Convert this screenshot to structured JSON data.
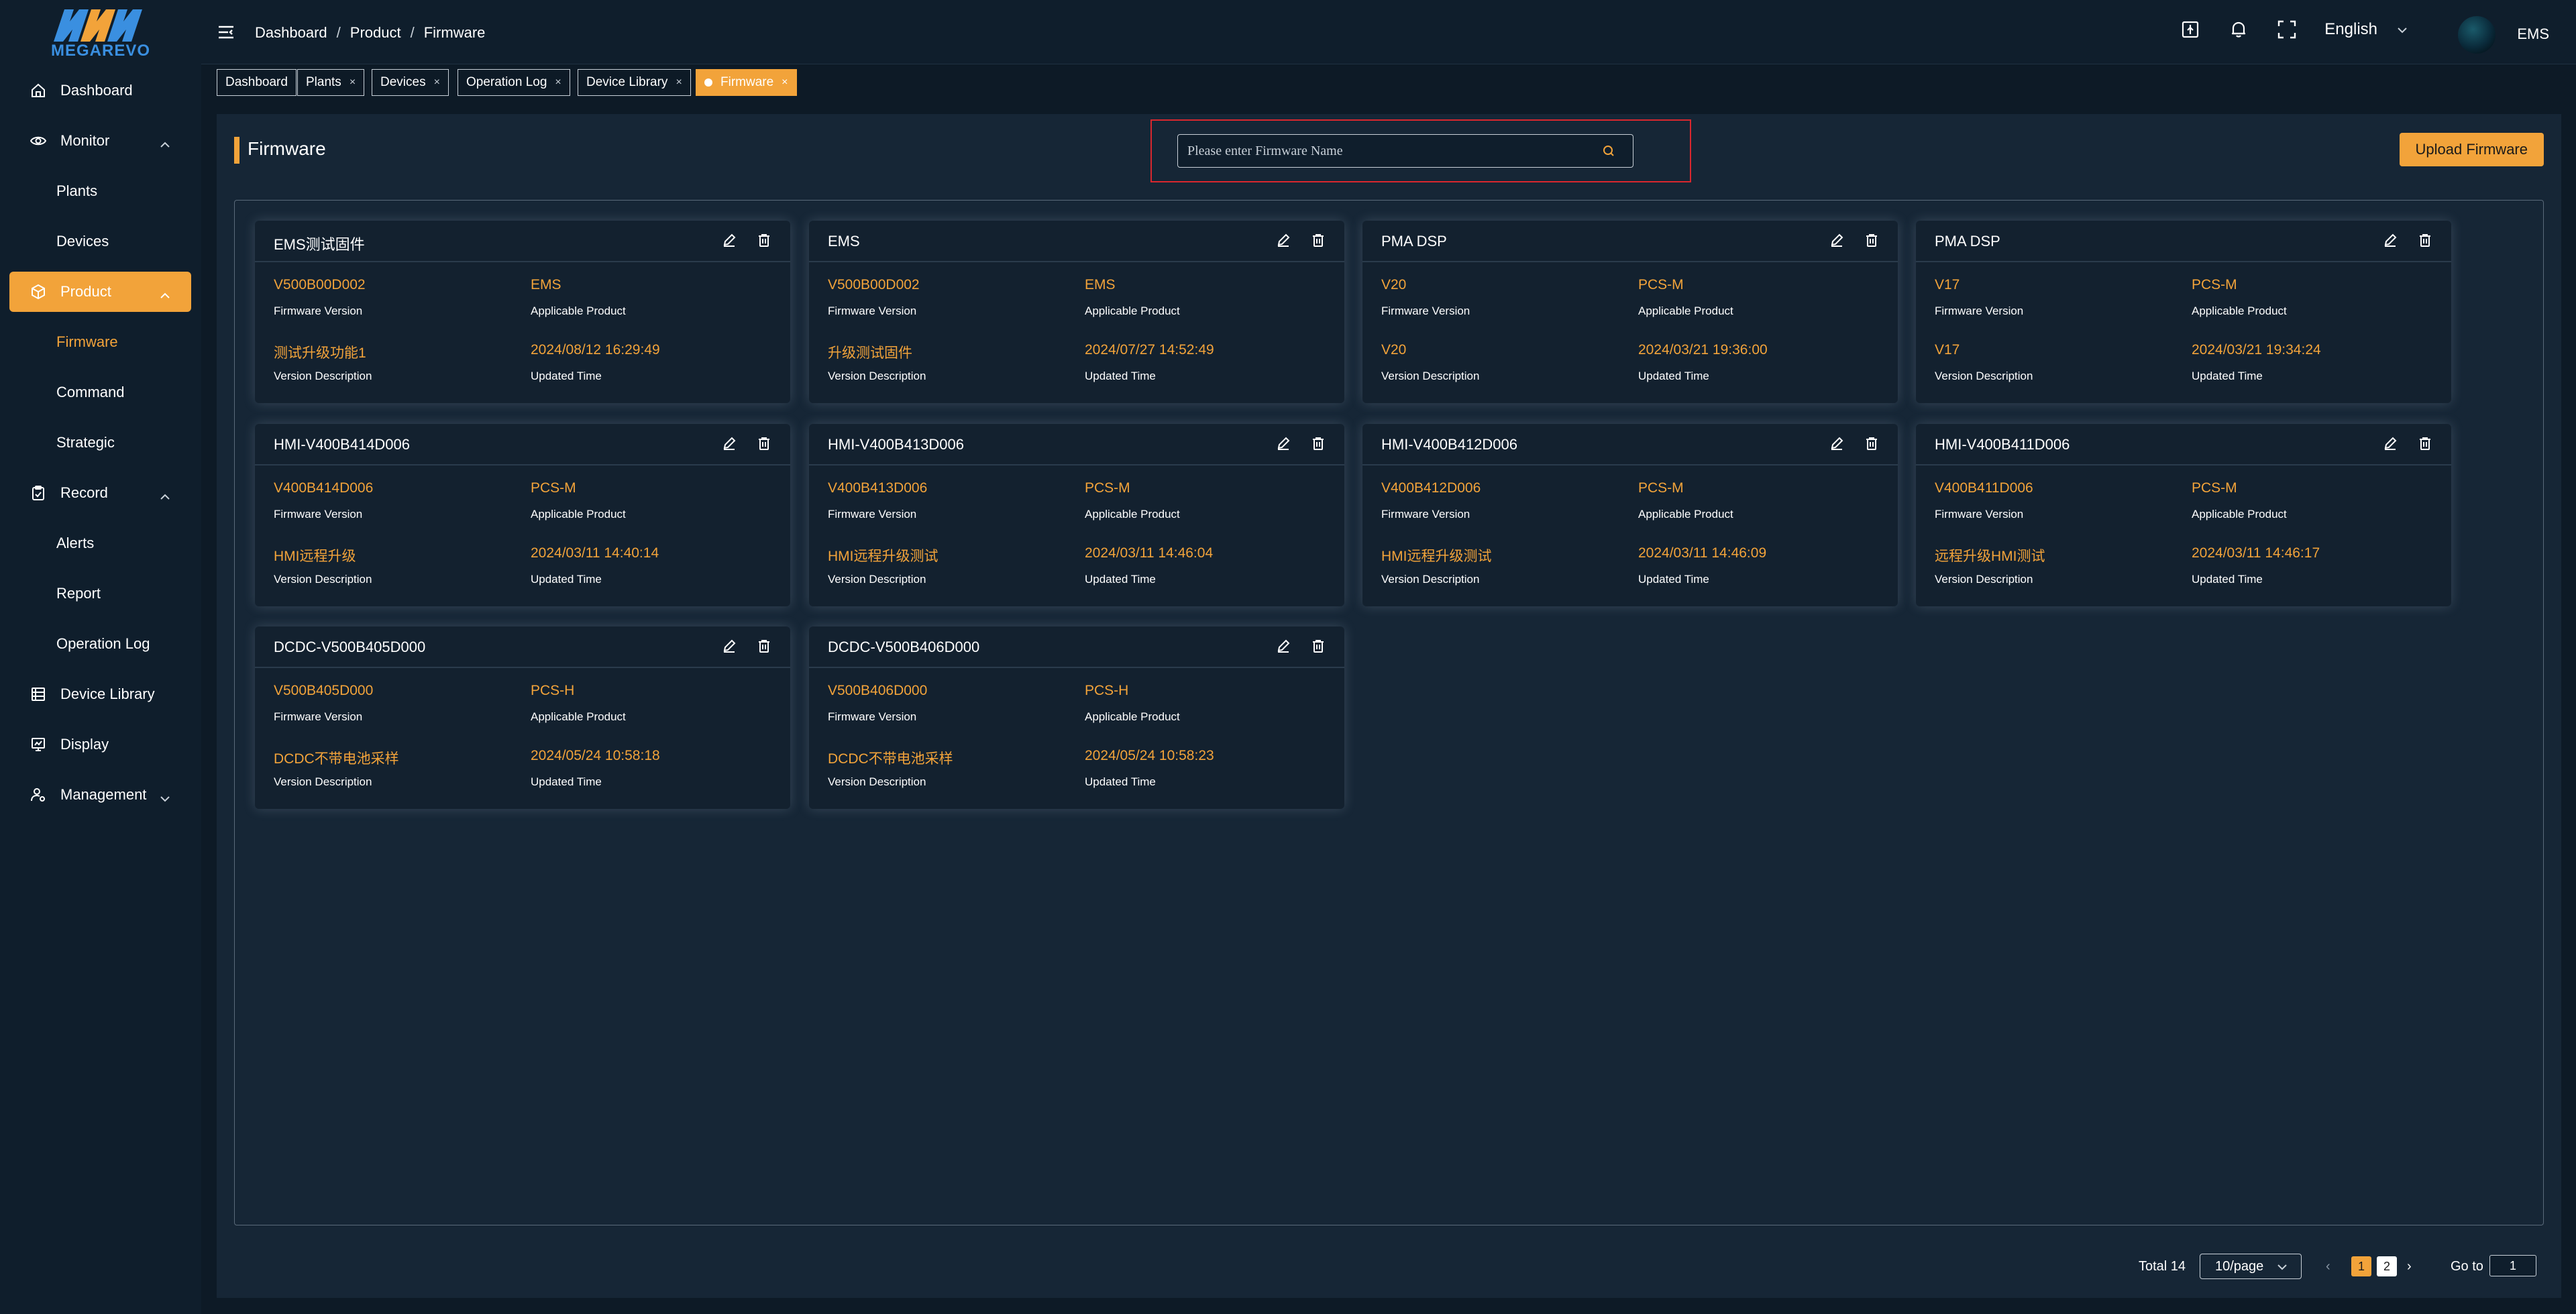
{
  "brand": {
    "logo_text": "MEGAREVO",
    "accent": "#f2a33a",
    "logo_blue": "#3a8fe0",
    "logo_orange": "#f2a33a"
  },
  "sidebar": {
    "items": [
      {
        "label": "Dashboard",
        "icon": "home-icon"
      },
      {
        "label": "Monitor",
        "icon": "eye-icon"
      },
      {
        "label": "Plants"
      },
      {
        "label": "Devices"
      },
      {
        "label": "Product",
        "icon": "box-icon"
      },
      {
        "label": "Firmware"
      },
      {
        "label": "Command"
      },
      {
        "label": "Strategic"
      },
      {
        "label": "Record",
        "icon": "clipboard-icon"
      },
      {
        "label": "Alerts"
      },
      {
        "label": "Report"
      },
      {
        "label": "Operation Log"
      },
      {
        "label": "Device Library",
        "icon": "library-icon"
      },
      {
        "label": "Display",
        "icon": "display-icon"
      },
      {
        "label": "Management",
        "icon": "user-gear-icon"
      }
    ]
  },
  "header": {
    "breadcrumb": [
      "Dashboard",
      "Product",
      "Firmware"
    ],
    "language": "English",
    "user": "EMS"
  },
  "tabs": [
    {
      "label": "Dashboard",
      "closable": false
    },
    {
      "label": "Plants",
      "closable": true
    },
    {
      "label": "Devices",
      "closable": true
    },
    {
      "label": "Operation Log",
      "closable": true
    },
    {
      "label": "Device Library",
      "closable": true
    },
    {
      "label": "Firmware",
      "closable": true,
      "active": true
    }
  ],
  "tab_close_glyph": "×",
  "page": {
    "title": "Firmware",
    "search_placeholder": "Please enter Firmware Name",
    "upload_label": "Upload Firmware"
  },
  "labels": {
    "firmware_version": "Firmware Version",
    "applicable_product": "Applicable Product",
    "version_description": "Version Description",
    "updated_time": "Updated Time"
  },
  "cards": [
    {
      "title": "EMS测试固件",
      "version": "V500B00D002",
      "product": "EMS",
      "description": "测试升级功能1",
      "updated": "2024/08/12 16:29:49"
    },
    {
      "title": "EMS",
      "version": "V500B00D002",
      "product": "EMS",
      "description": "升级测试固件",
      "updated": "2024/07/27 14:52:49"
    },
    {
      "title": "PMA DSP",
      "version": "V20",
      "product": "PCS-M",
      "description": "V20",
      "updated": "2024/03/21 19:36:00"
    },
    {
      "title": "PMA DSP",
      "version": "V17",
      "product": "PCS-M",
      "description": "V17",
      "updated": "2024/03/21 19:34:24"
    },
    {
      "title": "HMI-V400B414D006",
      "version": "V400B414D006",
      "product": "PCS-M",
      "description": "HMI远程升级",
      "updated": "2024/03/11 14:40:14"
    },
    {
      "title": "HMI-V400B413D006",
      "version": "V400B413D006",
      "product": "PCS-M",
      "description": "HMI远程升级测试",
      "updated": "2024/03/11 14:46:04"
    },
    {
      "title": "HMI-V400B412D006",
      "version": "V400B412D006",
      "product": "PCS-M",
      "description": "HMI远程升级测试",
      "updated": "2024/03/11 14:46:09"
    },
    {
      "title": "HMI-V400B411D006",
      "version": "V400B411D006",
      "product": "PCS-M",
      "description": "远程升级HMI测试",
      "updated": "2024/03/11 14:46:17"
    },
    {
      "title": "DCDC-V500B405D000",
      "version": "V500B405D000",
      "product": "PCS-H",
      "description": "DCDC不带电池采样",
      "updated": "2024/05/24 10:58:18"
    },
    {
      "title": "DCDC-V500B406D000",
      "version": "V500B406D000",
      "product": "PCS-H",
      "description": "DCDC不带电池采样",
      "updated": "2024/05/24 10:58:23"
    }
  ],
  "pagination": {
    "total_label": "Total 14",
    "page_size": "10/page",
    "pages": [
      "1",
      "2"
    ],
    "current_page": "1",
    "prev_glyph": "‹",
    "next_glyph": "›",
    "goto_label": "Go to",
    "goto_value": "1"
  }
}
